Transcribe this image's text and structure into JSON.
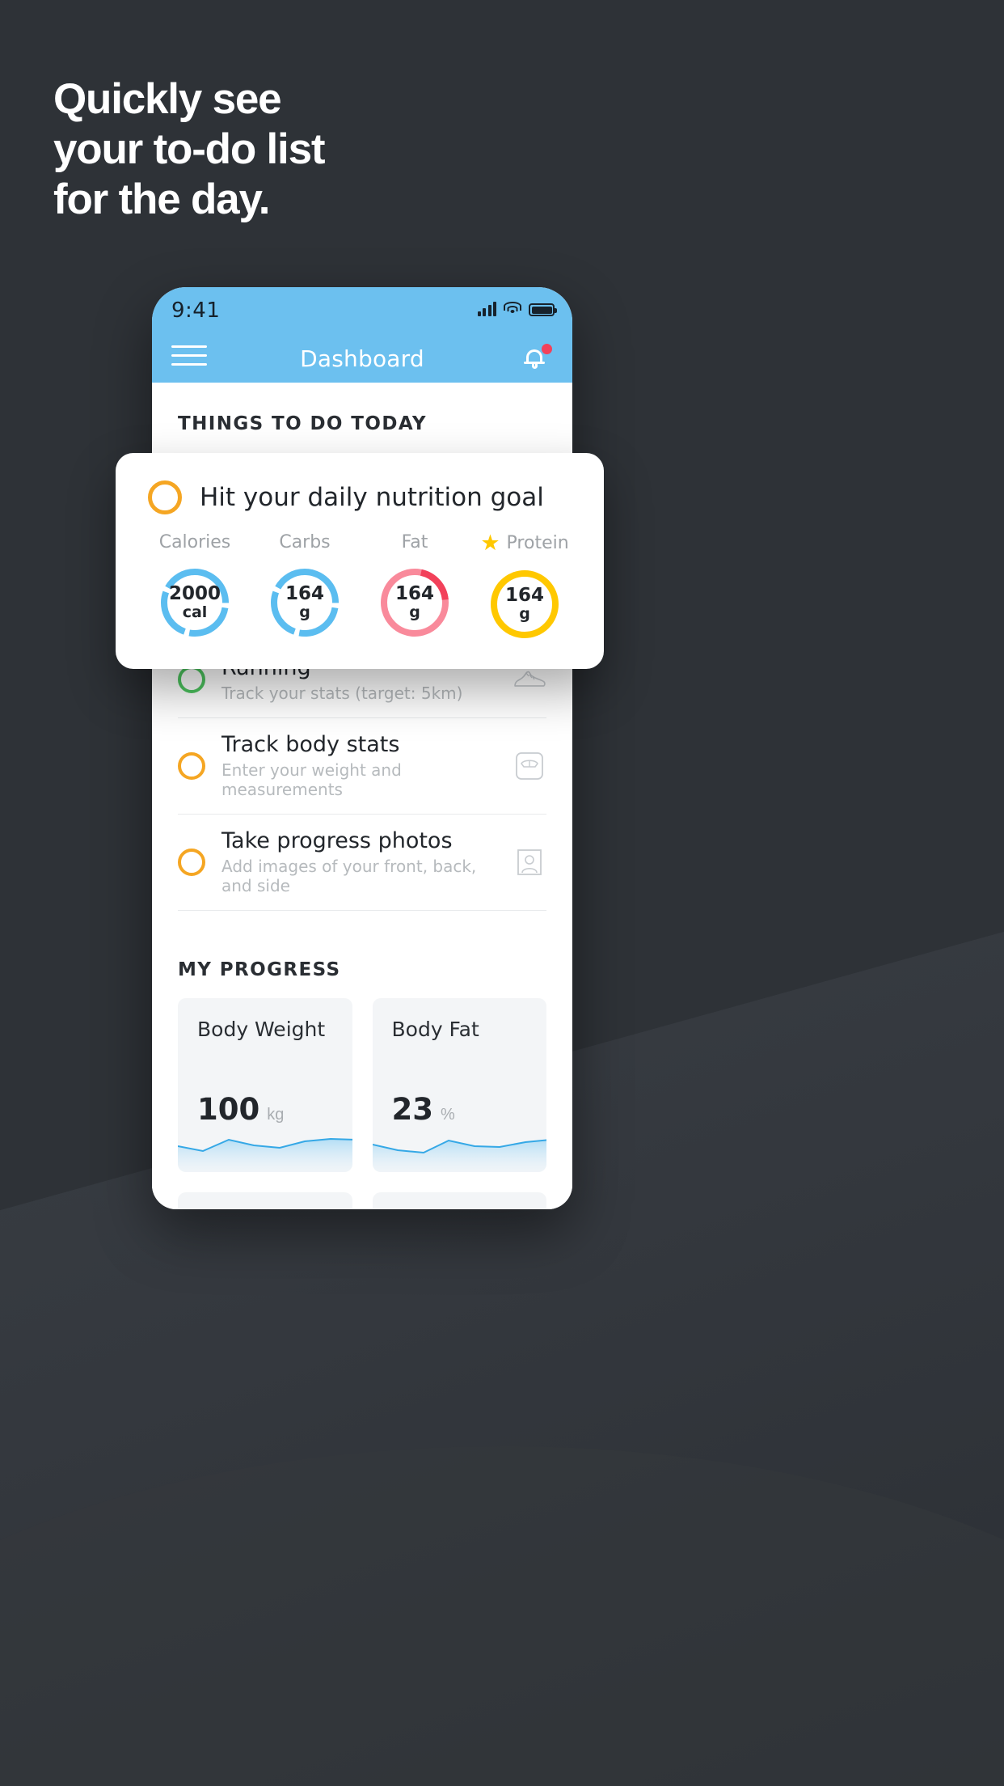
{
  "headline": {
    "line1": "Quickly see",
    "line2": "your to-do list",
    "line3": "for the day."
  },
  "colors": {
    "background": "#2e3237",
    "accent_blue": "#6cc0ef",
    "amber": "#f5a623",
    "green": "#4dc45f",
    "pink": "#f98a9b",
    "red": "#f2415a",
    "gold": "#ffc800",
    "card_grey": "#f3f5f7"
  },
  "status_bar": {
    "time": "9:41",
    "signal_icon": "cellular-signal-icon",
    "wifi_icon": "wifi-icon",
    "battery_icon": "battery-icon"
  },
  "nav": {
    "menu_icon": "hamburger-menu-icon",
    "title": "Dashboard",
    "bell_icon": "notification-bell-icon",
    "badge_visible": true
  },
  "sections": {
    "todo_title": "THINGS TO DO TODAY",
    "progress_title": "MY PROGRESS"
  },
  "nutrition_card": {
    "checkbox_icon": "circle-checkbox-icon",
    "title": "Hit your daily nutrition goal",
    "metrics": [
      {
        "label": "Calories",
        "value": "2000",
        "unit": "cal",
        "color": "#5bbdf0",
        "starred": false,
        "percent": 92
      },
      {
        "label": "Carbs",
        "value": "164",
        "unit": "g",
        "color": "#5bbdf0",
        "starred": false,
        "percent": 92
      },
      {
        "label": "Fat",
        "value": "164",
        "unit": "g",
        "color": "#f98a9b",
        "colorAlt": "#f2415a",
        "starred": false,
        "percent": 100
      },
      {
        "label": "Protein",
        "value": "164",
        "unit": "g",
        "color": "#ffc800",
        "starred": true,
        "star_icon": "star-icon",
        "percent": 100
      }
    ]
  },
  "tasks": [
    {
      "title": "Running",
      "subtitle": "Track your stats (target: 5km)",
      "ring_color": "#4dc45f",
      "icon": "running-shoe-icon"
    },
    {
      "title": "Track body stats",
      "subtitle": "Enter your weight and measurements",
      "ring_color": "#f5a623",
      "icon": "weight-scale-icon"
    },
    {
      "title": "Take progress photos",
      "subtitle": "Add images of your front, back, and side",
      "ring_color": "#f5a623",
      "icon": "photo-person-icon"
    }
  ],
  "progress_cards": [
    {
      "label": "Body Weight",
      "value": "100",
      "unit": "kg",
      "chart_icon": "sparkline-chart"
    },
    {
      "label": "Body Fat",
      "value": "23",
      "unit": "%",
      "chart_icon": "sparkline-chart"
    }
  ],
  "chart_data": [
    {
      "type": "area",
      "title": "Body Weight",
      "ylabel": "kg",
      "x": [
        0,
        1,
        2,
        3,
        4,
        5,
        6,
        7
      ],
      "values": [
        100,
        99,
        98,
        102,
        101,
        100,
        103,
        103
      ],
      "ylim": [
        96,
        105
      ],
      "grid": false,
      "legend": "none"
    },
    {
      "type": "area",
      "title": "Body Fat",
      "ylabel": "%",
      "x": [
        0,
        1,
        2,
        3,
        4,
        5,
        6,
        7
      ],
      "values": [
        23,
        22.4,
        21.8,
        23.4,
        22.6,
        22.5,
        23.2,
        23.5
      ],
      "ylim": [
        21,
        24.5
      ],
      "grid": false,
      "legend": "none"
    }
  ]
}
